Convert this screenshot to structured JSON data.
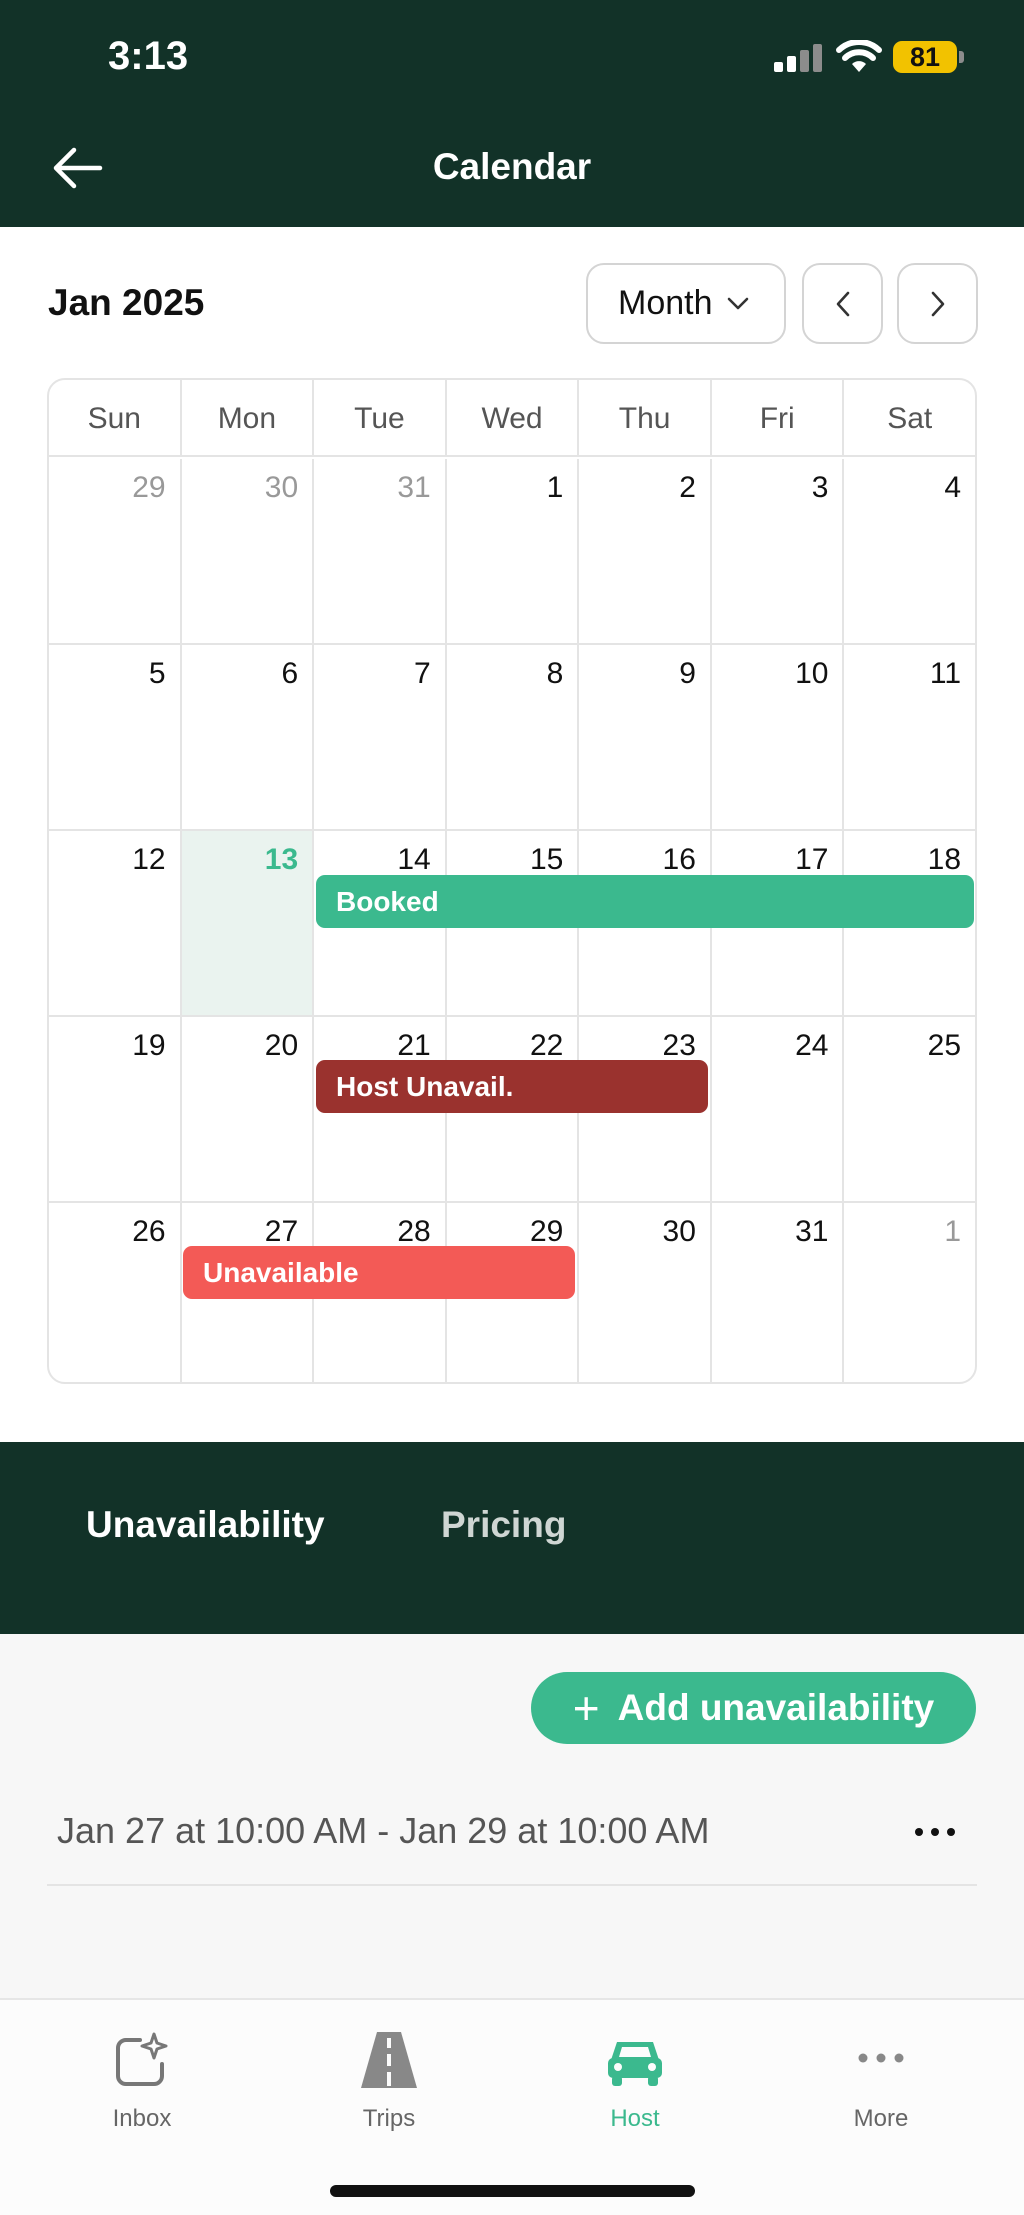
{
  "status_bar": {
    "time": "3:13",
    "battery": "81"
  },
  "header": {
    "title": "Calendar",
    "back_icon": "arrow-left-icon"
  },
  "calendar": {
    "month_label": "Jan 2025",
    "view_select": "Month",
    "weekdays": [
      "Sun",
      "Mon",
      "Tue",
      "Wed",
      "Thu",
      "Fri",
      "Sat"
    ],
    "weeks": [
      [
        "29",
        "30",
        "31",
        "1",
        "2",
        "3",
        "4"
      ],
      [
        "5",
        "6",
        "7",
        "8",
        "9",
        "10",
        "11"
      ],
      [
        "12",
        "13",
        "14",
        "15",
        "16",
        "17",
        "18"
      ],
      [
        "19",
        "20",
        "21",
        "22",
        "23",
        "24",
        "25"
      ],
      [
        "26",
        "27",
        "28",
        "29",
        "30",
        "31",
        "1"
      ]
    ],
    "events": [
      {
        "label": "Booked",
        "color": "#3bb98e"
      },
      {
        "label": "Host Unavail.",
        "color": "#9a322e"
      },
      {
        "label": "Unavailable",
        "color": "#f35a56"
      }
    ]
  },
  "tabs": [
    {
      "label": "Unavailability",
      "active": true
    },
    {
      "label": "Pricing",
      "active": false
    }
  ],
  "content": {
    "add_button": "Add unavailability",
    "entries": [
      {
        "range": "Jan 27 at 10:00 AM - Jan 29 at 10:00 AM"
      }
    ]
  },
  "bottom_nav": [
    {
      "label": "Inbox",
      "icon": "inbox-sparkle-icon"
    },
    {
      "label": "Trips",
      "icon": "road-icon"
    },
    {
      "label": "Host",
      "icon": "car-icon",
      "active": true
    },
    {
      "label": "More",
      "icon": "more-dots-icon"
    }
  ],
  "colors": {
    "header_bg": "#123228",
    "accent": "#3bb98e",
    "today_bg": "#eaf3ef"
  }
}
